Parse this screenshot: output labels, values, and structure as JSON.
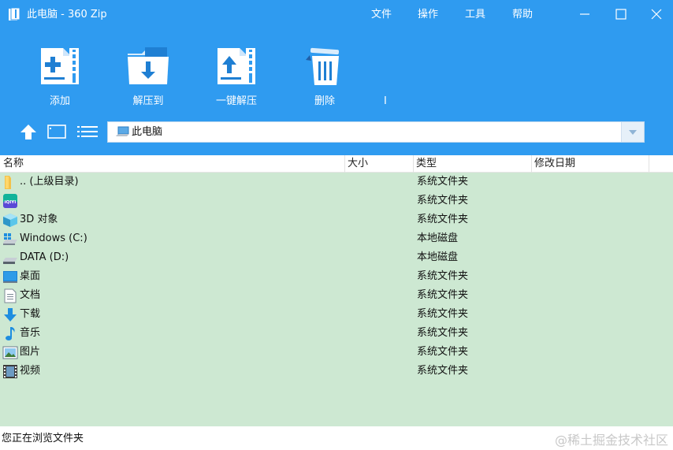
{
  "window": {
    "title": "此电脑 - 360 Zip",
    "menu": [
      "文件",
      "操作",
      "工具",
      "帮助"
    ]
  },
  "toolbar": {
    "buttons": [
      {
        "label": "添加",
        "icon": "add-archive-icon"
      },
      {
        "label": "解压到",
        "icon": "extract-to-icon"
      },
      {
        "label": "一键解压",
        "icon": "one-click-extract-icon"
      },
      {
        "label": "删除",
        "icon": "trash-icon"
      }
    ],
    "stray_text": "I"
  },
  "nav": {
    "path": "此电脑"
  },
  "columns": [
    "名称",
    "大小",
    "类型",
    "修改日期"
  ],
  "rows": [
    {
      "name": ".. (上级目录)",
      "type": "系统文件夹",
      "icon": "parent-folder-icon"
    },
    {
      "name": "",
      "type": "系统文件夹",
      "icon": "iqiyi-icon",
      "icon_text": "iQIYI"
    },
    {
      "name": "3D 对象",
      "type": "系统文件夹",
      "icon": "3d-objects-icon"
    },
    {
      "name": "Windows (C:)",
      "type": "本地磁盘",
      "icon": "windows-drive-icon"
    },
    {
      "name": "DATA (D:)",
      "type": "本地磁盘",
      "icon": "drive-icon"
    },
    {
      "name": "桌面",
      "type": "系统文件夹",
      "icon": "desktop-icon"
    },
    {
      "name": "文档",
      "type": "系统文件夹",
      "icon": "documents-icon"
    },
    {
      "name": "下载",
      "type": "系统文件夹",
      "icon": "download-icon"
    },
    {
      "name": "音乐",
      "type": "系统文件夹",
      "icon": "music-icon"
    },
    {
      "name": "图片",
      "type": "系统文件夹",
      "icon": "pictures-icon"
    },
    {
      "name": "视频",
      "type": "系统文件夹",
      "icon": "videos-icon"
    }
  ],
  "status": {
    "text": "您正在浏览文件夹",
    "watermark": "@稀土掘金技术社区"
  },
  "colors": {
    "header_blue": "#2f9bf0",
    "list_green": "#cde8d2"
  }
}
